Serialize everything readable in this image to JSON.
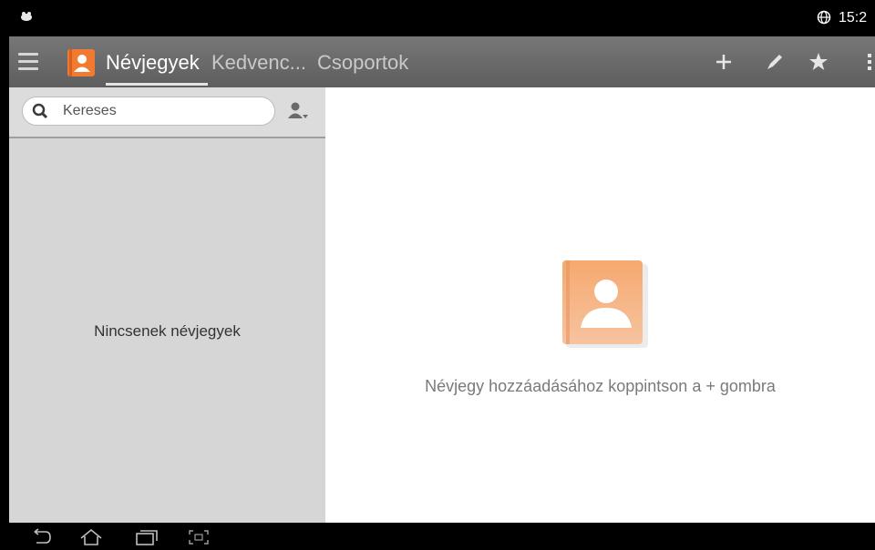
{
  "status_bar": {
    "time": "15:2",
    "icons": [
      "notification-icon",
      "globe-icon"
    ]
  },
  "action_bar": {
    "tabs": [
      {
        "label": "Névjegyek",
        "active": true
      },
      {
        "label": "Kedvenc...",
        "active": false
      },
      {
        "label": "Csoportok",
        "active": false
      }
    ],
    "actions": [
      "add-icon",
      "edit-icon",
      "star-icon",
      "overflow-menu-icon"
    ],
    "colors": {
      "bar": "#6c6c6c",
      "accent": "#f07a30"
    }
  },
  "left_panel": {
    "search": {
      "placeholder": "Kereses",
      "value": ""
    },
    "empty_message": "Nincsenek névjegyek"
  },
  "right_panel": {
    "hint": "Névjegy hozzáadásához koppintson a + gombra"
  },
  "nav_bar": {
    "icons": [
      "back-icon",
      "home-icon",
      "recent-apps-icon",
      "screenshot-icon"
    ]
  }
}
